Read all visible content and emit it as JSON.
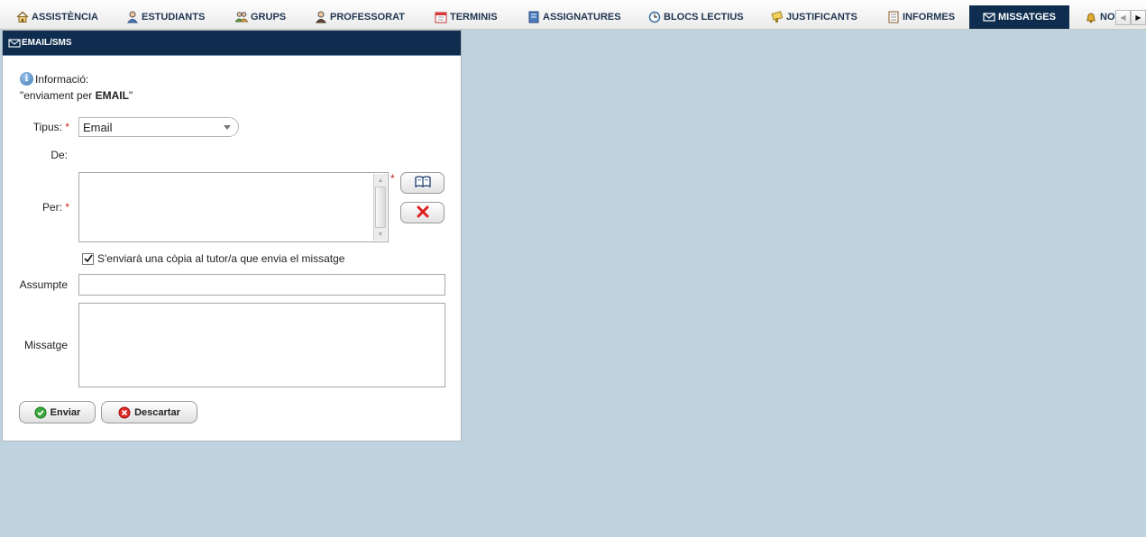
{
  "tabs": [
    {
      "label": "ASSISTÈNCIA",
      "icon": "home-icon"
    },
    {
      "label": "ESTUDIANTS",
      "icon": "student-icon"
    },
    {
      "label": "GRUPS",
      "icon": "group-icon"
    },
    {
      "label": "PROFESSORAT",
      "icon": "teacher-icon"
    },
    {
      "label": "TERMINIS",
      "icon": "calendar-icon"
    },
    {
      "label": "ASSIGNATURES",
      "icon": "book-icon"
    },
    {
      "label": "BLOCS LECTIUS",
      "icon": "clock-icon"
    },
    {
      "label": "JUSTIFICANTS",
      "icon": "justify-icon"
    },
    {
      "label": "INFORMES",
      "icon": "report-icon"
    },
    {
      "label": "MISSATGES",
      "icon": "envelope-icon",
      "active": true
    },
    {
      "label": "NOT",
      "icon": "bell-icon"
    }
  ],
  "panel": {
    "title": "EMAIL/SMS",
    "info_label": "Informació:",
    "info_prefix": "\"enviament per ",
    "info_bold": "EMAIL",
    "info_suffix": "\""
  },
  "form": {
    "tipus_label": "Tipus:",
    "tipus_value": "Email",
    "de_label": "De:",
    "per_label": "Per:",
    "required_mark": "*",
    "copy_checkbox_label": "S'enviarà una còpia al tutor/a que envia el missatge",
    "copy_checked": true,
    "assumpte_label": "Assumpte",
    "missatge_label": "Missatge"
  },
  "buttons": {
    "send": "Enviar",
    "discard": "Descartar"
  },
  "colors": {
    "header_bg": "#0f2e4f",
    "page_bg": "#bfd3de",
    "required": "#d01919"
  }
}
